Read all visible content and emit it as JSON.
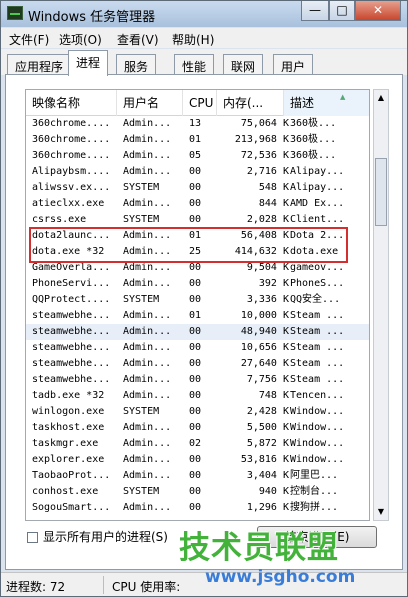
{
  "window": {
    "title": "Windows 任务管理器",
    "minimize": "—",
    "maximize": "□",
    "close": "✕"
  },
  "menubar": [
    "文件(F)",
    "选项(O)",
    "查看(V)",
    "帮助(H)"
  ],
  "tabs": [
    "应用程序",
    "进程",
    "服务",
    "性能",
    "联网",
    "用户"
  ],
  "active_tab": "进程",
  "columns": [
    "映像名称",
    "用户名",
    "CPU",
    "内存(...",
    "描述"
  ],
  "rows": [
    {
      "name": "360chrome....",
      "user": "Admin...",
      "cpu": "13",
      "mem": "75,064 K",
      "desc": "360极..."
    },
    {
      "name": "360chrome....",
      "user": "Admin...",
      "cpu": "01",
      "mem": "213,968 K",
      "desc": "360极..."
    },
    {
      "name": "360chrome....",
      "user": "Admin...",
      "cpu": "05",
      "mem": "72,536 K",
      "desc": "360极..."
    },
    {
      "name": "Alipaybsm....",
      "user": "Admin...",
      "cpu": "00",
      "mem": "2,716 K",
      "desc": "Alipay..."
    },
    {
      "name": "aliwssv.ex...",
      "user": "SYSTEM",
      "cpu": "00",
      "mem": "548 K",
      "desc": "Alipay..."
    },
    {
      "name": "atieclxx.exe",
      "user": "Admin...",
      "cpu": "00",
      "mem": "844 K",
      "desc": "AMD Ex..."
    },
    {
      "name": "csrss.exe",
      "user": "SYSTEM",
      "cpu": "00",
      "mem": "2,028 K",
      "desc": "Client..."
    },
    {
      "name": "dota2launc...",
      "user": "Admin...",
      "cpu": "01",
      "mem": "56,408 K",
      "desc": "Dota 2..."
    },
    {
      "name": "dota.exe *32",
      "user": "Admin...",
      "cpu": "25",
      "mem": "414,632 K",
      "desc": "dota.exe"
    },
    {
      "name": "GameOverla...",
      "user": "Admin...",
      "cpu": "00",
      "mem": "9,504 K",
      "desc": "gameov..."
    },
    {
      "name": "PhoneServi...",
      "user": "Admin...",
      "cpu": "00",
      "mem": "392 K",
      "desc": "PhoneS..."
    },
    {
      "name": "QQProtect....",
      "user": "SYSTEM",
      "cpu": "00",
      "mem": "3,336 K",
      "desc": "QQ安全..."
    },
    {
      "name": "steamwebhe...",
      "user": "Admin...",
      "cpu": "01",
      "mem": "10,000 K",
      "desc": "Steam ..."
    },
    {
      "name": "steamwebhe...",
      "user": "Admin...",
      "cpu": "00",
      "mem": "48,940 K",
      "desc": "Steam ..."
    },
    {
      "name": "steamwebhe...",
      "user": "Admin...",
      "cpu": "00",
      "mem": "10,656 K",
      "desc": "Steam ..."
    },
    {
      "name": "steamwebhe...",
      "user": "Admin...",
      "cpu": "00",
      "mem": "27,640 K",
      "desc": "Steam ..."
    },
    {
      "name": "steamwebhe...",
      "user": "Admin...",
      "cpu": "00",
      "mem": "7,756 K",
      "desc": "Steam ..."
    },
    {
      "name": "tadb.exe *32",
      "user": "Admin...",
      "cpu": "00",
      "mem": "748 K",
      "desc": "Tencen..."
    },
    {
      "name": "winlogon.exe",
      "user": "SYSTEM",
      "cpu": "00",
      "mem": "2,428 K",
      "desc": "Window..."
    },
    {
      "name": "taskhost.exe",
      "user": "Admin...",
      "cpu": "00",
      "mem": "5,500 K",
      "desc": "Window..."
    },
    {
      "name": "taskmgr.exe",
      "user": "Admin...",
      "cpu": "02",
      "mem": "5,872 K",
      "desc": "Window..."
    },
    {
      "name": "explorer.exe",
      "user": "Admin...",
      "cpu": "00",
      "mem": "53,816 K",
      "desc": "Window..."
    },
    {
      "name": "TaobaoProt...",
      "user": "Admin...",
      "cpu": "00",
      "mem": "3,404 K",
      "desc": "阿里巴..."
    },
    {
      "name": "conhost.exe",
      "user": "SYSTEM",
      "cpu": "00",
      "mem": "940 K",
      "desc": "控制台..."
    },
    {
      "name": "SogouSmart...",
      "user": "Admin...",
      "cpu": "00",
      "mem": "1,296 K",
      "desc": "搜狗拼..."
    }
  ],
  "selected_row": "steamwebhe...",
  "show_all_label": "显示所有用户的进程(S)",
  "end_process_label": "结束进程(E)",
  "status": {
    "processes": "进程数: 72",
    "cpu": "CPU 使用率:"
  },
  "watermark": {
    "text": "技术员联盟",
    "url": "www.jsgho.com"
  },
  "colors": {
    "highlight_box": "#d32f2f",
    "selected_row": "#e7eef8",
    "watermark": "#42b23a"
  }
}
